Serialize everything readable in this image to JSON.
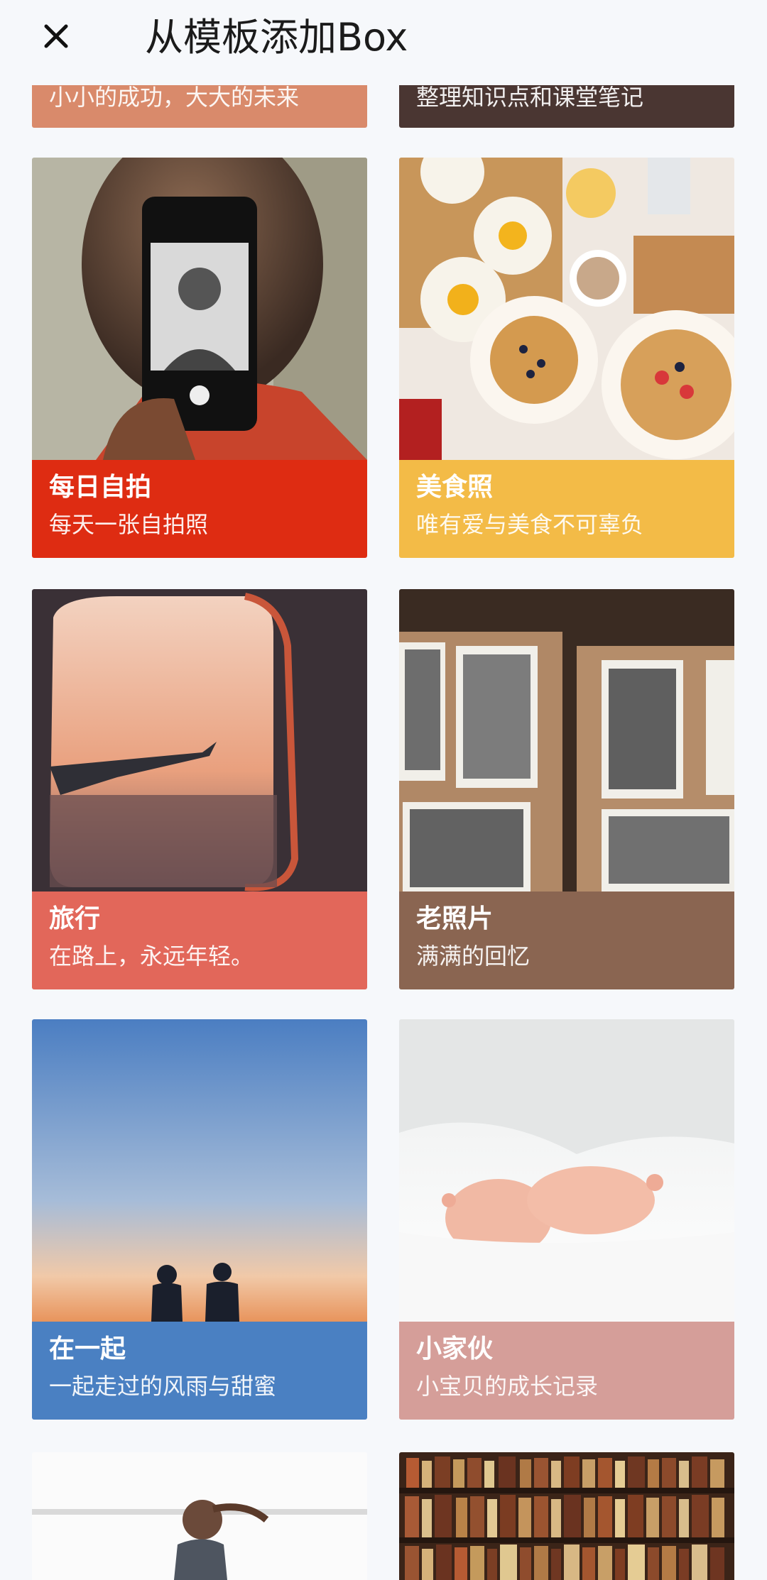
{
  "header": {
    "title": "从模板添加Box"
  },
  "partial_top": [
    {
      "subtitle": "小小的成功，大大的未来",
      "color": "#d98a6b"
    },
    {
      "subtitle": "整理知识点和课堂笔记",
      "color": "#4a3632"
    }
  ],
  "templates": [
    {
      "title": "每日自拍",
      "subtitle": "每天一张自拍照",
      "color": "#de2c12"
    },
    {
      "title": "美食照",
      "subtitle": "唯有爱与美食不可辜负",
      "color": "#f3bb47"
    },
    {
      "title": "旅行",
      "subtitle": "在路上，永远年轻。",
      "color": "#e2675a"
    },
    {
      "title": "老照片",
      "subtitle": "满满的回忆",
      "color": "#8a6551"
    },
    {
      "title": "在一起",
      "subtitle": "一起走过的风雨与甜蜜",
      "color": "#4a80c2"
    },
    {
      "title": "小家伙",
      "subtitle": "小宝贝的成长记录",
      "color": "#d59e99"
    }
  ],
  "icons": {
    "close": "close-icon"
  }
}
